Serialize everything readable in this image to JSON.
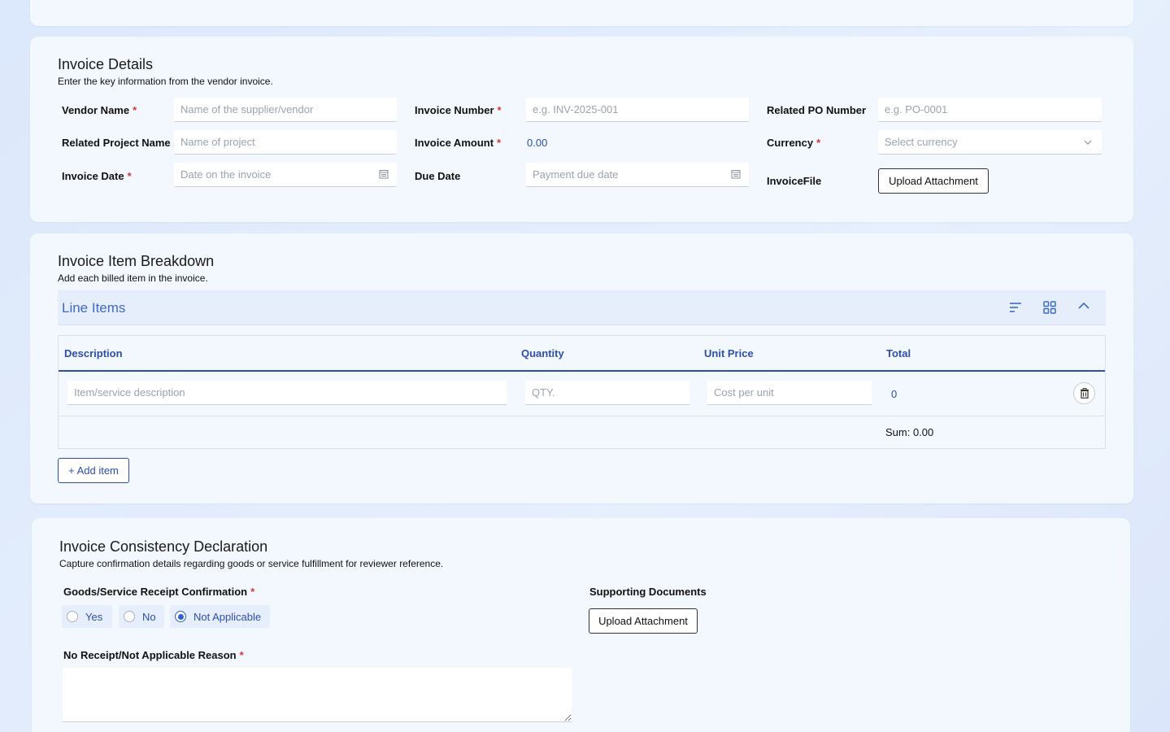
{
  "invoice_details": {
    "title": "Invoice Details",
    "subtitle": "Enter the key information from the vendor invoice.",
    "vendor_name": {
      "label": "Vendor Name",
      "placeholder": "Name of the supplier/vendor"
    },
    "invoice_number": {
      "label": "Invoice Number",
      "placeholder": "e.g.  INV-2025-001"
    },
    "related_po": {
      "label": "Related PO Number",
      "placeholder": "e.g. PO-0001"
    },
    "related_project": {
      "label": "Related Project Name",
      "placeholder": "Name of project"
    },
    "invoice_amount": {
      "label": "Invoice Amount",
      "value": "0.00"
    },
    "currency": {
      "label": "Currency",
      "placeholder": "Select currency"
    },
    "invoice_date": {
      "label": "Invoice Date",
      "placeholder": "Date on the invoice"
    },
    "due_date": {
      "label": "Due Date",
      "placeholder": "Payment due date"
    },
    "invoice_file": {
      "label": "InvoiceFile",
      "button": "Upload Attachment"
    },
    "required_mark": "*"
  },
  "breakdown": {
    "title": "Invoice Item Breakdown",
    "subtitle": "Add each billed item in the invoice.",
    "panel_title": "Line Items",
    "columns": [
      "Description",
      "Quantity",
      "Unit Price",
      "Total"
    ],
    "row": {
      "description_placeholder": "Item/service description",
      "qty_placeholder": "QTY.",
      "price_placeholder": "Cost per unit",
      "total": "0"
    },
    "sum": "Sum: 0.00",
    "add_item": "+ Add item"
  },
  "consistency": {
    "title": "Invoice Consistency Declaration",
    "subtitle": "Capture confirmation details regarding goods or service fulfillment for reviewer reference.",
    "receipt_label": "Goods/Service Receipt Confirmation",
    "options": [
      "Yes",
      "No",
      "Not Applicable"
    ],
    "selected": "Not Applicable",
    "supporting_label": "Supporting Documents",
    "supporting_button": "Upload Attachment",
    "reason_label": "No Receipt/Not Applicable Reason"
  },
  "icons": {
    "calendar": "calendar-icon",
    "chevron": "chevron-down-icon",
    "sort": "sort-icon",
    "grid": "grid-icon",
    "collapse": "chevron-up-icon",
    "delete": "trash-icon"
  },
  "colors": {
    "accent": "#2c4fa8",
    "required": "#d23a3a",
    "radio": "#2f5fd0"
  }
}
